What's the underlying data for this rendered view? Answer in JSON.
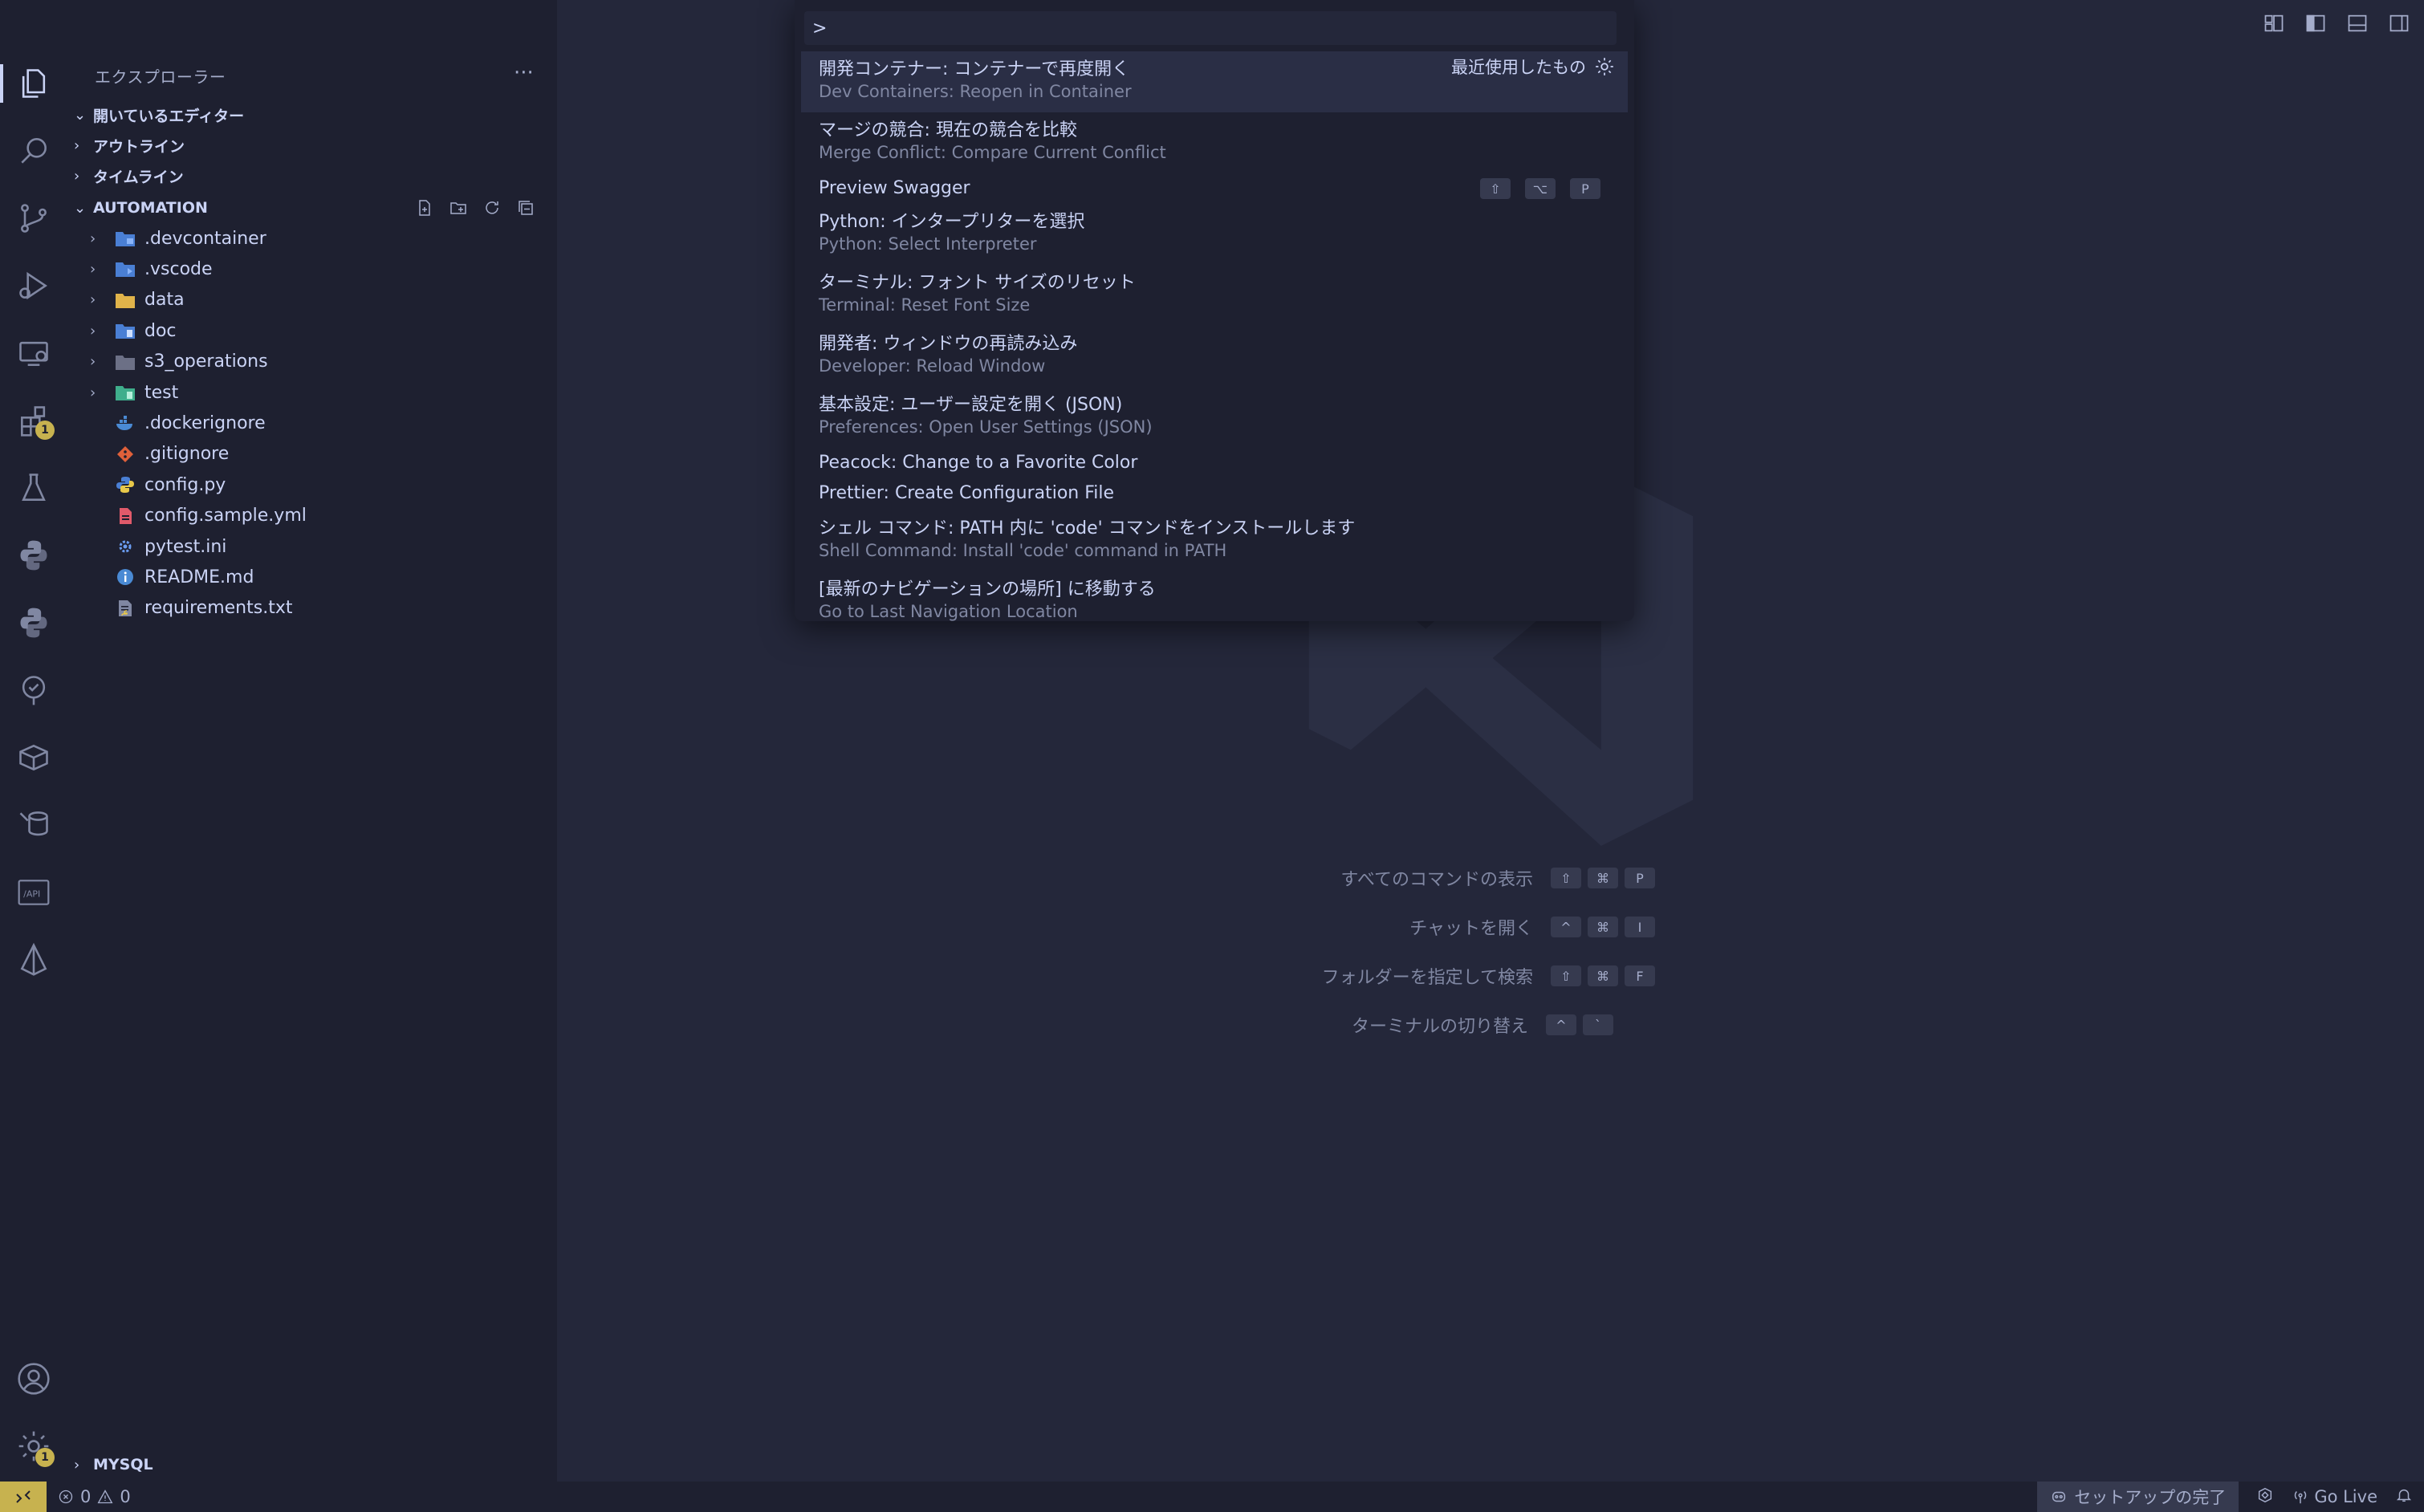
{
  "sidebar": {
    "title": "エクスプローラー",
    "sections": {
      "open_editors": "開いているエディター",
      "outline": "アウトライン",
      "timeline": "タイムライン",
      "automation": "AUTOMATION",
      "mysql": "MYSQL"
    },
    "tree": [
      {
        "name": ".devcontainer",
        "type": "folder",
        "icon": "devcontainer-folder-icon"
      },
      {
        "name": ".vscode",
        "type": "folder",
        "icon": "vscode-folder-icon"
      },
      {
        "name": "data",
        "type": "folder",
        "icon": "data-folder-icon"
      },
      {
        "name": "doc",
        "type": "folder",
        "icon": "doc-folder-icon"
      },
      {
        "name": "s3_operations",
        "type": "folder",
        "icon": "folder-icon"
      },
      {
        "name": "test",
        "type": "folder",
        "icon": "test-folder-icon"
      },
      {
        "name": ".dockerignore",
        "type": "file",
        "icon": "docker-icon"
      },
      {
        "name": ".gitignore",
        "type": "file",
        "icon": "git-icon"
      },
      {
        "name": "config.py",
        "type": "file",
        "icon": "python-icon"
      },
      {
        "name": "config.sample.yml",
        "type": "file",
        "icon": "yaml-icon"
      },
      {
        "name": "pytest.ini",
        "type": "file",
        "icon": "settings-file-icon"
      },
      {
        "name": "README.md",
        "type": "file",
        "icon": "info-icon"
      },
      {
        "name": "requirements.txt",
        "type": "file",
        "icon": "requirements-icon"
      }
    ]
  },
  "activity_bar": {
    "extensions_badge": "1",
    "settings_badge": "1"
  },
  "palette": {
    "input_value": ">",
    "recent_label": "最近使用したもの",
    "items": [
      {
        "main": "開発コンテナー: コンテナーで再度開く",
        "sub": "Dev Containers: Reopen in Container"
      },
      {
        "main": "マージの競合: 現在の競合を比較",
        "sub": "Merge Conflict: Compare Current Conflict"
      },
      {
        "main": "Preview Swagger",
        "sub": "",
        "keys": [
          "⇧",
          "⌥",
          "P"
        ]
      },
      {
        "main": "Python: インタープリターを選択",
        "sub": "Python: Select Interpreter"
      },
      {
        "main": "ターミナル: フォント サイズのリセット",
        "sub": "Terminal: Reset Font Size"
      },
      {
        "main": "開発者: ウィンドウの再読み込み",
        "sub": "Developer: Reload Window"
      },
      {
        "main": "基本設定: ユーザー設定を開く (JSON)",
        "sub": "Preferences: Open User Settings (JSON)"
      },
      {
        "main": "Peacock: Change to a Favorite Color",
        "sub": ""
      },
      {
        "main": "Prettier: Create Configuration File",
        "sub": ""
      },
      {
        "main": "シェル コマンド: PATH 内に 'code' コマンドをインストールします",
        "sub": "Shell Command: Install 'code' command in PATH"
      },
      {
        "main": "[最新のナビゲーションの場所] に移動する",
        "sub": "Go to Last Navigation Location"
      }
    ]
  },
  "hints": [
    {
      "label": "すべてのコマンドの表示",
      "keys": [
        "⇧",
        "⌘",
        "P"
      ]
    },
    {
      "label": "チャットを開く",
      "keys": [
        "^",
        "⌘",
        "I"
      ]
    },
    {
      "label": "フォルダーを指定して検索",
      "keys": [
        "⇧",
        "⌘",
        "F"
      ]
    },
    {
      "label": "ターミナルの切り替え",
      "keys": [
        "^",
        "`"
      ]
    }
  ],
  "statusbar": {
    "errors": "0",
    "warnings": "0",
    "setup": "セットアップの完了",
    "go_live": "Go Live"
  },
  "colors": {
    "background": "#24273a",
    "sidebar": "#1e2030",
    "accent": "#c7b24f",
    "text": "#cad3f5",
    "muted": "#8087a2"
  }
}
